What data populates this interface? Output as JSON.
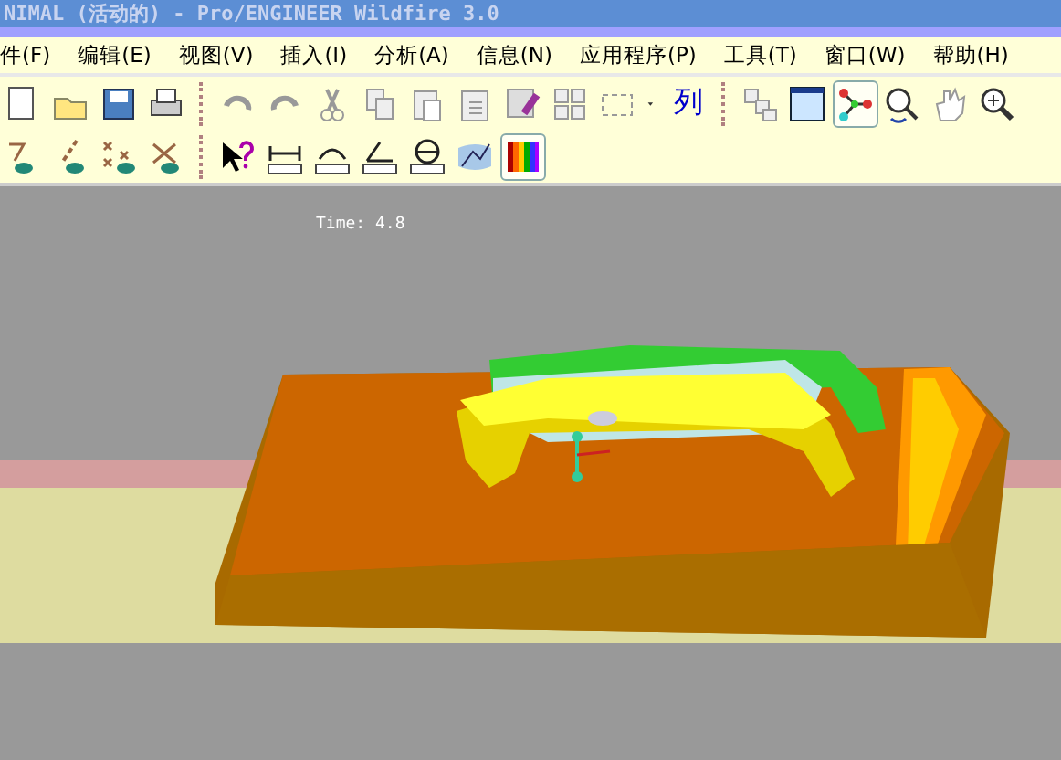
{
  "window": {
    "title": "NIMAL (活动的) - Pro/ENGINEER Wildfire 3.0"
  },
  "menu_bar": [
    "件(F)",
    "编辑(E)",
    "视图(V)",
    "插入(I)",
    "分析(A)",
    "信息(N)",
    "应用程序(P)",
    "工具(T)",
    "窗口(W)",
    "帮助(H)"
  ],
  "toolbar_rows": [
    [
      {
        "kind": "document",
        "selected": false
      },
      {
        "kind": "open",
        "selected": false
      },
      {
        "kind": "save",
        "selected": false
      },
      {
        "kind": "print",
        "selected": false
      },
      {
        "kind": "separator"
      },
      {
        "kind": "undo",
        "selected": false
      },
      {
        "kind": "redo",
        "selected": false
      },
      {
        "kind": "cut",
        "selected": false
      },
      {
        "kind": "copy",
        "selected": false
      },
      {
        "kind": "paste",
        "selected": false
      },
      {
        "kind": "paste-special",
        "selected": false
      },
      {
        "kind": "eraser",
        "selected": false
      },
      {
        "kind": "boxes",
        "selected": false
      },
      {
        "kind": "select-box",
        "selected": false
      },
      {
        "kind": "dropdown",
        "selected": false
      },
      {
        "kind": "text",
        "label": "列",
        "selected": false
      },
      {
        "kind": "separator"
      },
      {
        "kind": "windows",
        "selected": false
      },
      {
        "kind": "window",
        "selected": false
      },
      {
        "kind": "joint",
        "selected": true
      },
      {
        "kind": "zoom-spin",
        "selected": false
      },
      {
        "kind": "hand",
        "selected": false
      },
      {
        "kind": "zoom",
        "selected": false
      }
    ],
    [
      {
        "kind": "datum-plane",
        "selected": false
      },
      {
        "kind": "datum-axis",
        "selected": false
      },
      {
        "kind": "datum-point",
        "selected": false
      },
      {
        "kind": "datum-csys",
        "selected": false
      },
      {
        "kind": "separator"
      },
      {
        "kind": "help",
        "selected": false
      },
      {
        "kind": "measure-distance",
        "selected": false
      },
      {
        "kind": "measure-length",
        "selected": false
      },
      {
        "kind": "measure-angle",
        "selected": false
      },
      {
        "kind": "measure-diameter",
        "selected": false
      },
      {
        "kind": "graph",
        "selected": false
      },
      {
        "kind": "spectrum",
        "selected": true
      }
    ]
  ],
  "viewport": {
    "time_label": "Time: 4.8"
  }
}
